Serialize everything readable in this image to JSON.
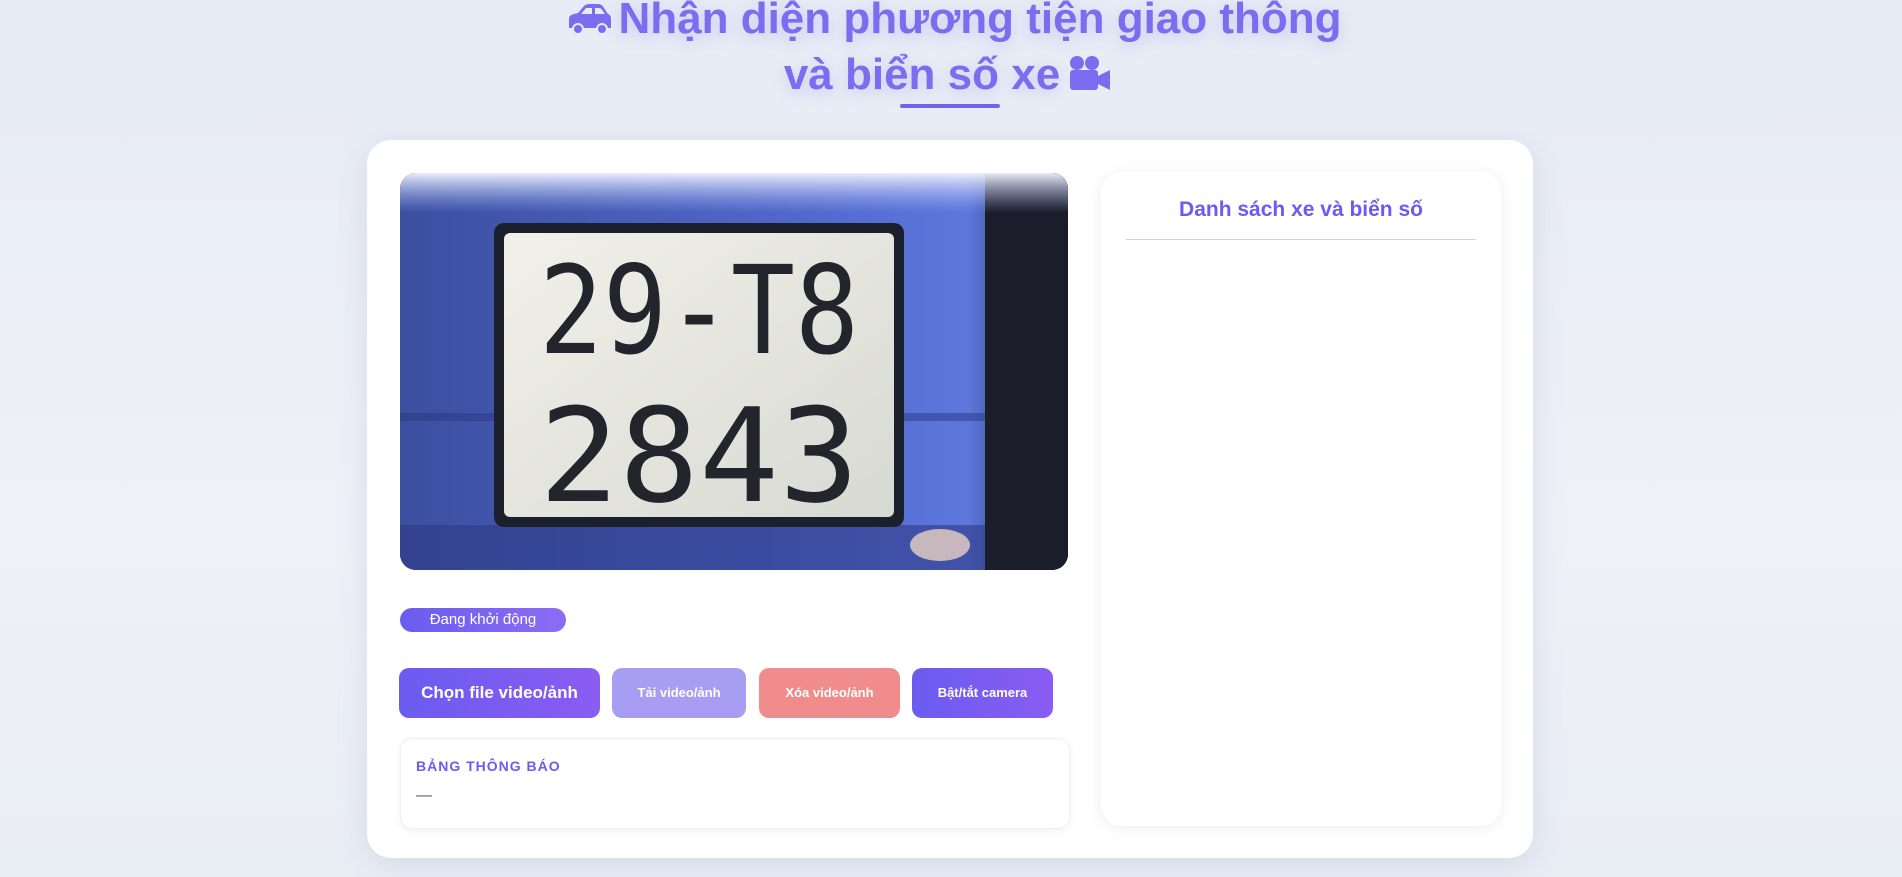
{
  "header": {
    "title_line1": "Nhận diện phương tiện giao thông",
    "title_line2": "và biển số xe",
    "left_icon": "car-icon",
    "right_icon": "video-camera-icon"
  },
  "video": {
    "plate_line1": "29-T8",
    "plate_line2": "2843"
  },
  "status": {
    "label": "Đang khởi động"
  },
  "controls": {
    "choose_label": "Chọn file video/ảnh",
    "upload_label": "Tải video/ảnh",
    "delete_label": "Xóa video/ảnh",
    "camera_label": "Bật/tắt camera"
  },
  "notice": {
    "title": "BẢNG THÔNG BÁO",
    "text": "—"
  },
  "list_panel": {
    "title": "Danh sách xe và biển số"
  },
  "colors": {
    "accent": "#6a5cf0",
    "delete": "#f08c8c",
    "upload": "#a79ef4",
    "background": "#e7ebf5"
  }
}
